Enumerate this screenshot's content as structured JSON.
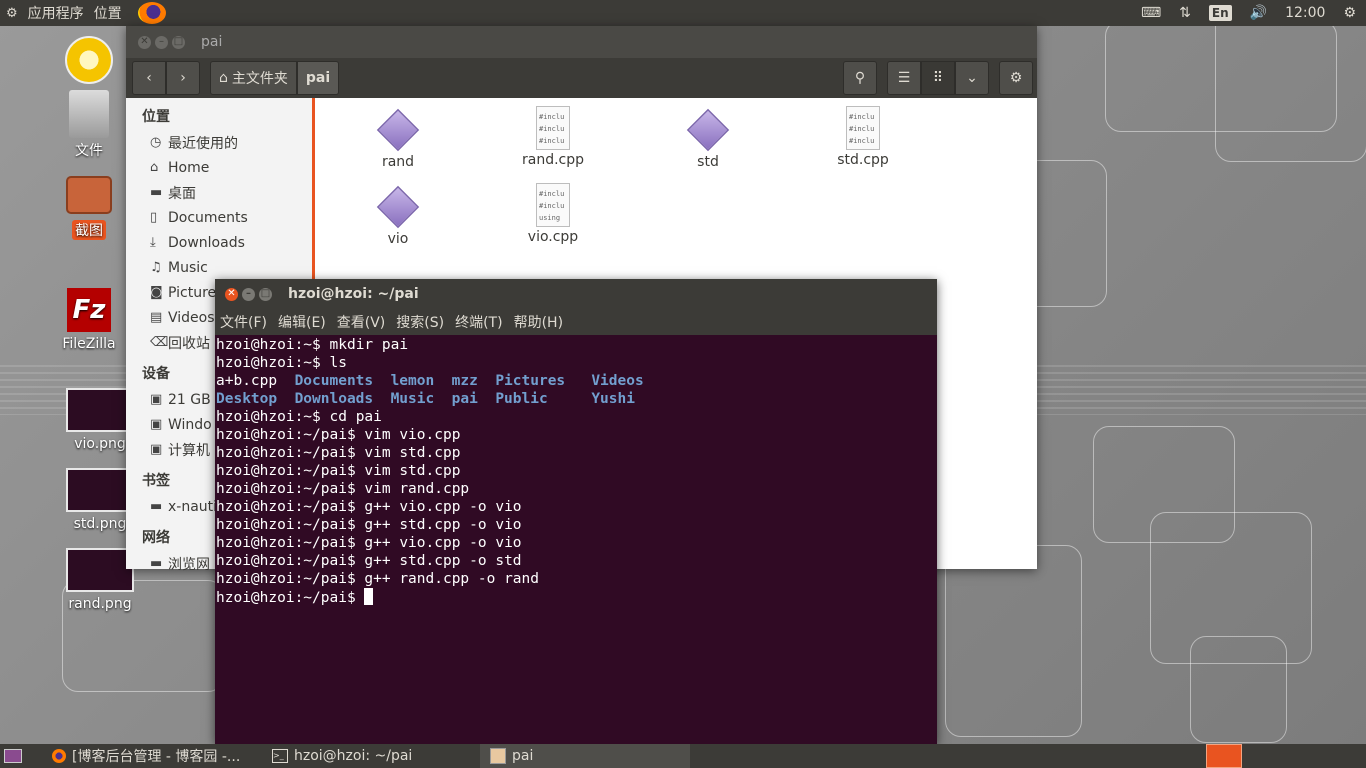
{
  "top_panel": {
    "menus": [
      "应用程序",
      "位置"
    ],
    "time": "12:00",
    "keyboard_layout": "En"
  },
  "desktop": {
    "icons": [
      {
        "label": "文件"
      },
      {
        "label": "截图"
      },
      {
        "label": "FileZilla"
      },
      {
        "label": "vio.png"
      },
      {
        "label": "std.png"
      },
      {
        "label": "rand.png"
      }
    ]
  },
  "nautilus": {
    "title": "pai",
    "path": [
      "主文件夹",
      "pai"
    ],
    "sidebar": {
      "sections": [
        {
          "heading": "位置",
          "items": [
            {
              "label": "最近使用的",
              "icon": "clock-icon"
            },
            {
              "label": "Home",
              "icon": "home-icon"
            },
            {
              "label": "桌面",
              "icon": "folder-icon"
            },
            {
              "label": "Documents",
              "icon": "document-icon"
            },
            {
              "label": "Downloads",
              "icon": "download-icon"
            },
            {
              "label": "Music",
              "icon": "music-icon"
            },
            {
              "label": "Picture",
              "icon": "camera-icon"
            },
            {
              "label": "Videos",
              "icon": "film-icon"
            },
            {
              "label": "回收站",
              "icon": "trash-icon"
            }
          ]
        },
        {
          "heading": "设备",
          "items": [
            {
              "label": "21 GB",
              "icon": "drive-icon"
            },
            {
              "label": "Windo",
              "icon": "drive-icon"
            },
            {
              "label": "计算机",
              "icon": "drive-icon"
            }
          ]
        },
        {
          "heading": "书签",
          "items": [
            {
              "label": "x-nauti",
              "icon": "network-icon"
            }
          ]
        },
        {
          "heading": "网络",
          "items": [
            {
              "label": "浏览网",
              "icon": "network-icon"
            }
          ]
        }
      ]
    },
    "files": [
      {
        "name": "rand",
        "type": "exec"
      },
      {
        "name": "rand.cpp",
        "type": "source",
        "preview": [
          "#inclu",
          "#inclu",
          "#inclu"
        ]
      },
      {
        "name": "std",
        "type": "exec"
      },
      {
        "name": "std.cpp",
        "type": "source",
        "preview": [
          "#inclu",
          "#inclu",
          "#inclu"
        ]
      },
      {
        "name": "vio",
        "type": "exec"
      },
      {
        "name": "vio.cpp",
        "type": "source",
        "preview": [
          "#inclu",
          "#inclu",
          "using r"
        ]
      }
    ]
  },
  "terminal": {
    "title": "hzoi@hzoi: ~/pai",
    "menu": [
      "文件(F)",
      "编辑(E)",
      "查看(V)",
      "搜索(S)",
      "终端(T)",
      "帮助(H)"
    ],
    "lines": [
      {
        "prompt": "hzoi@hzoi:~$ ",
        "cmd": "mkdir pai"
      },
      {
        "prompt": "hzoi@hzoi:~$ ",
        "cmd": "ls"
      },
      {
        "ls_row": [
          [
            "a+b.cpp",
            false
          ],
          [
            "Documents",
            true
          ],
          [
            "lemon",
            true
          ],
          [
            "mzz",
            true
          ],
          [
            "Pictures",
            true
          ],
          [
            "Videos",
            true
          ]
        ]
      },
      {
        "ls_row": [
          [
            "Desktop",
            true
          ],
          [
            "Downloads",
            true
          ],
          [
            "Music",
            true
          ],
          [
            "pai",
            true
          ],
          [
            "Public",
            true
          ],
          [
            "Yushi",
            true
          ]
        ]
      },
      {
        "prompt": "hzoi@hzoi:~$ ",
        "cmd": "cd pai"
      },
      {
        "prompt": "hzoi@hzoi:~/pai$ ",
        "cmd": "vim vio.cpp"
      },
      {
        "prompt": "hzoi@hzoi:~/pai$ ",
        "cmd": "vim std.cpp"
      },
      {
        "prompt": "hzoi@hzoi:~/pai$ ",
        "cmd": "vim std.cpp"
      },
      {
        "prompt": "hzoi@hzoi:~/pai$ ",
        "cmd": "vim rand.cpp"
      },
      {
        "prompt": "hzoi@hzoi:~/pai$ ",
        "cmd": "g++ vio.cpp -o vio"
      },
      {
        "prompt": "hzoi@hzoi:~/pai$ ",
        "cmd": "g++ std.cpp -o vio"
      },
      {
        "prompt": "hzoi@hzoi:~/pai$ ",
        "cmd": "g++ vio.cpp -o vio"
      },
      {
        "prompt": "hzoi@hzoi:~/pai$ ",
        "cmd": "g++ std.cpp -o std"
      },
      {
        "prompt": "hzoi@hzoi:~/pai$ ",
        "cmd": "g++ rand.cpp -o rand"
      },
      {
        "prompt": "hzoi@hzoi:~/pai$ ",
        "cmd": "",
        "cursor": true
      }
    ]
  },
  "taskbar": {
    "tasks": [
      {
        "label": "[博客后台管理 - 博客园 -...",
        "icon": "firefox-icon"
      },
      {
        "label": "hzoi@hzoi: ~/pai",
        "icon": "terminal-icon"
      },
      {
        "label": "pai",
        "icon": "file-manager-icon"
      }
    ]
  },
  "colors": {
    "terminal_bg": "#300a24",
    "ubuntu_orange": "#e95420",
    "panel": "#3c3b37",
    "ls_dir": "#729fcf"
  }
}
